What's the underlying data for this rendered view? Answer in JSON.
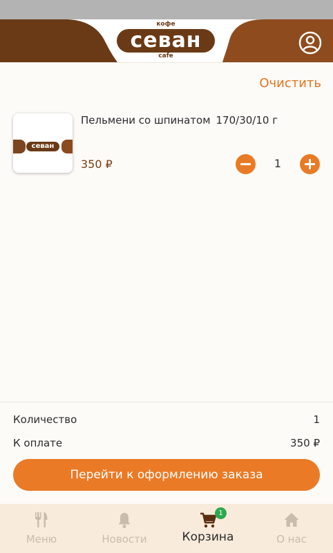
{
  "header": {
    "logo_main": "севан",
    "logo_top": "кофе",
    "logo_bottom": "cafe",
    "profile_icon": "user-circle-icon",
    "brand_color": "#6a3a16"
  },
  "cart": {
    "clear_label": "Очистить",
    "items": [
      {
        "name": "Пельмени со шпинатом",
        "weight": "170/30/10 г",
        "price": "350 ₽",
        "quantity": "1",
        "thumb_logo": "севан"
      }
    ]
  },
  "summary": {
    "quantity_label": "Количество",
    "quantity_value": "1",
    "total_label": "К оплате",
    "total_value": "350 ₽",
    "checkout_label": "Перейти к оформлению заказа"
  },
  "tabs": [
    {
      "label": "Меню",
      "icon": "fork-knife-icon",
      "active": false
    },
    {
      "label": "Новости",
      "icon": "bell-icon",
      "active": false
    },
    {
      "label": "Корзина",
      "icon": "cart-icon",
      "active": true,
      "badge": "1"
    },
    {
      "label": "О нас",
      "icon": "home-icon",
      "active": false
    }
  ],
  "colors": {
    "accent": "#ea7a26",
    "tabbar_bg": "#f8ebdb",
    "badge": "#2fa84f",
    "price": "#7a3d12"
  }
}
